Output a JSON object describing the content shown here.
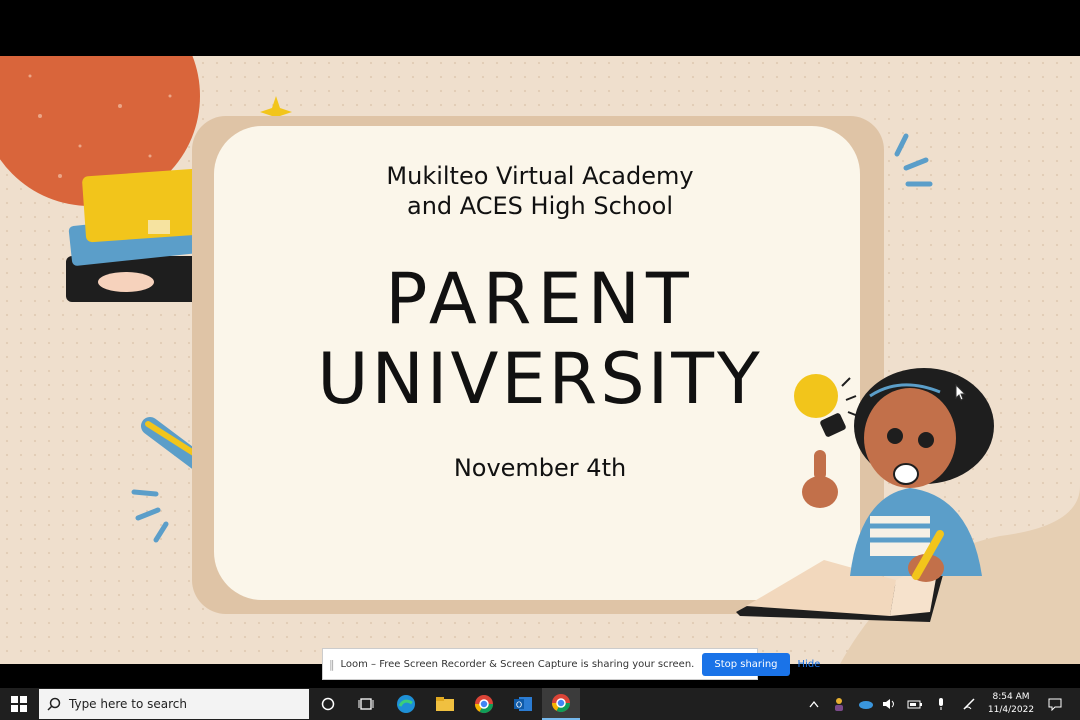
{
  "slide": {
    "line1": "Mukilteo Virtual Academy",
    "line2": "and ACES High School",
    "title_line1": "PARENT",
    "title_line2": "UNIVERSITY",
    "date": "November 4th"
  },
  "loom": {
    "message": "Loom – Free Screen Recorder & Screen Capture is sharing your screen.",
    "stop_label": "Stop sharing",
    "hide_label": "Hide"
  },
  "taskbar": {
    "search_placeholder": "Type here to search",
    "time": "8:54 AM",
    "date": "11/4/2022"
  },
  "icons": [
    "windows-start-icon",
    "search-icon",
    "cortana-icon",
    "task-view-icon",
    "edge-icon",
    "file-explorer-icon",
    "chrome-icon",
    "outlook-icon",
    "chrome-icon",
    "chevron-up-icon",
    "people-icon",
    "onedrive-icon",
    "volume-icon",
    "battery-icon",
    "microphone-icon",
    "pen-icon",
    "notification-icon"
  ],
  "colors": {
    "slide_bg": "#efdfcd",
    "card_bg": "#fbf6ea",
    "card_border": "#dfc4a6",
    "accent_orange": "#d9653b",
    "accent_blue": "#5b9ec9",
    "accent_yellow": "#f2c51b",
    "loom_button": "#1a73e8",
    "taskbar": "#1f1f1f"
  }
}
